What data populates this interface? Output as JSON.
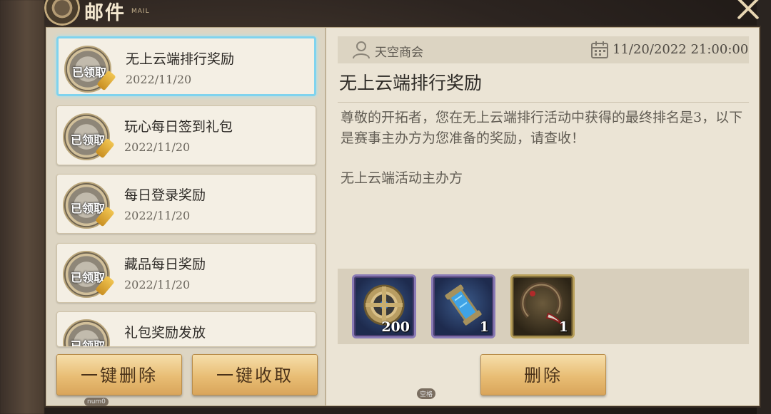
{
  "header": {
    "title": "邮件",
    "subtitle": "MAIL"
  },
  "mail_list": [
    {
      "title": "无上云端排行奖励",
      "date": "2022/11/20",
      "status": "已领取",
      "selected": true
    },
    {
      "title": "玩心每日签到礼包",
      "date": "2022/11/20",
      "status": "已领取",
      "selected": false
    },
    {
      "title": "每日登录奖励",
      "date": "2022/11/20",
      "status": "已领取",
      "selected": false
    },
    {
      "title": "藏品每日奖励",
      "date": "2022/11/20",
      "status": "已领取",
      "selected": false
    },
    {
      "title": "礼包奖励发放",
      "date": "",
      "status": "已领取",
      "selected": false
    }
  ],
  "actions": {
    "delete_all": "一键删除",
    "collect_all": "一键收取",
    "delete": "删除"
  },
  "detail": {
    "sender": "天空商会",
    "datetime": "11/20/2022 21:00:00",
    "title": "无上云端排行奖励",
    "body": "尊敬的开拓者，您在无上云端排行活动中获得的最终排名是3，以下是赛事主办方为您准备的奖励，请查收！",
    "signature": "无上云端活动主办方"
  },
  "rewards": [
    {
      "icon": "gear-shield-icon",
      "count": "200"
    },
    {
      "icon": "energy-canister-icon",
      "count": "1"
    },
    {
      "icon": "curved-blade-icon",
      "count": "1"
    }
  ],
  "hints": {
    "left": "num0",
    "center": "空格"
  },
  "colors": {
    "selected_border": "#7fd3ee",
    "button_gold": "#e8bd74"
  }
}
